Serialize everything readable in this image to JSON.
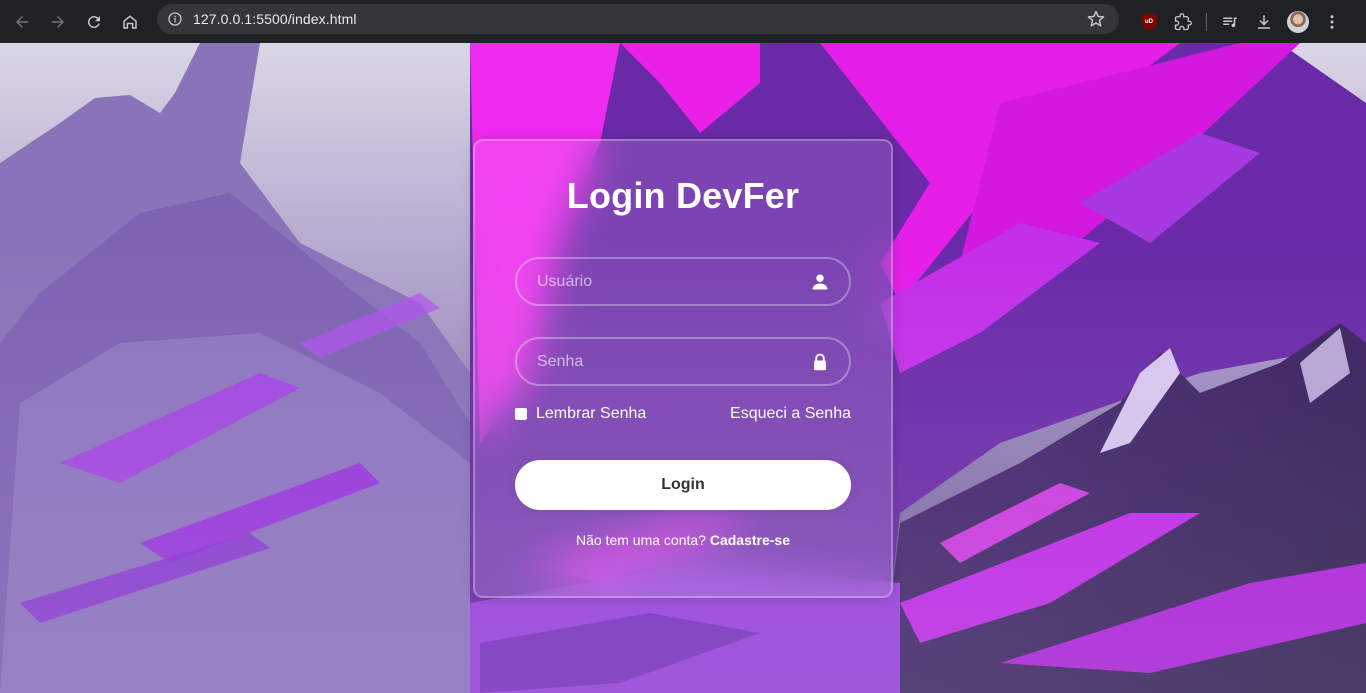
{
  "browser": {
    "url": "127.0.0.1:5500/index.html",
    "extensions": [
      "ublock-origin",
      "puzzle-extensions-icon",
      "media-controls-icon",
      "download-icon",
      "profile-avatar",
      "kebab-menu-icon"
    ],
    "ublock_label": "uD"
  },
  "login": {
    "title": "Login DevFer",
    "username_placeholder": "Usuário",
    "password_placeholder": "Senha",
    "remember_label": "Lembrar Senha",
    "forgot_label": "Esqueci a Senha",
    "button_label": "Login",
    "register_text": "Não tem uma conta?",
    "register_link": "Cadastre-se"
  },
  "colors": {
    "accent_magenta": "#e617ee",
    "accent_purple": "#8e3fd0",
    "button_bg": "#ffffff"
  }
}
